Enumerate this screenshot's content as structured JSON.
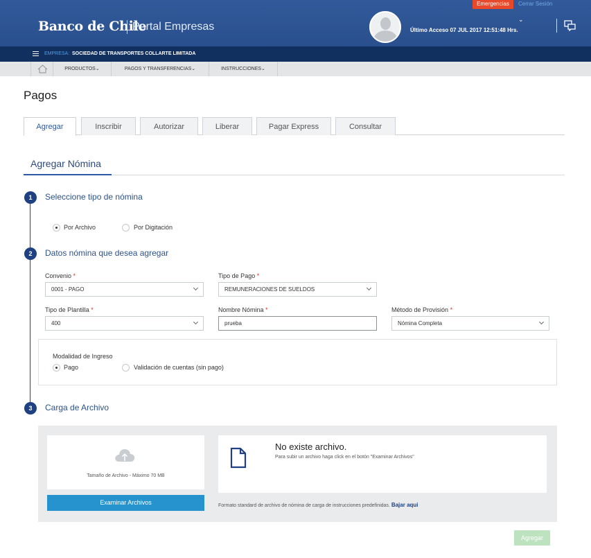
{
  "header": {
    "logo": "Banco de Chile",
    "portal": "Portal Empresas",
    "emergency_label": "Emergencias",
    "logout_label": "Cerrar Sesión",
    "last_access": "Último Acceso 07 JUL 2017 12:51:48 Hrs."
  },
  "company": {
    "label": "EMPRESA:",
    "name": "SOCIEDAD DE TRANSPORTES COLLARTE LIMITADA"
  },
  "nav": {
    "items": [
      "PRODUCTOS",
      "PAGOS Y TRANSFERENCIAS",
      "INSTRUCCIONES"
    ]
  },
  "page": {
    "title": "Pagos",
    "tabs": [
      "Agregar",
      "Inscribir",
      "Autorizar",
      "Liberar",
      "Pagar Express",
      "Consultar"
    ],
    "active_tab": "Agregar",
    "subtitle": "Agregar Nómina"
  },
  "steps": [
    {
      "num": "1",
      "title": "Seleccione tipo de nómina"
    },
    {
      "num": "2",
      "title": "Datos nómina que desea agregar"
    },
    {
      "num": "3",
      "title": "Carga de Archivo"
    }
  ],
  "nomina_type": {
    "options": [
      "Por Archivo",
      "Por Digitación"
    ],
    "selected": "Por Archivo"
  },
  "form": {
    "convenio": {
      "label": "Convenio",
      "value": "0001 - PAGO"
    },
    "tipo_pago": {
      "label": "Tipo de Pago",
      "value": "REMUNERACIONES DE SUELDOS"
    },
    "tipo_plantilla": {
      "label": "Tipo de Plantilla",
      "value": "400"
    },
    "nombre_nomina": {
      "label": "Nombre Nómina",
      "value": "prueba"
    },
    "metodo_provision": {
      "label": "Método de Provisión",
      "value": "Nómina Completa"
    },
    "required_mark": "*"
  },
  "modalidad": {
    "label": "Modalidad de Ingreso",
    "options": [
      "Pago",
      "Validación de cuentas (sin pago)"
    ],
    "selected": "Pago"
  },
  "upload": {
    "size_label": "Tamaño de Archivo - Máximo 70 MB",
    "browse_label": "Examinar Archivos",
    "no_file_title": "No existe archivo.",
    "no_file_desc": "Para subir un archivo haga click en el botón \"Examinar Archivos\"",
    "format_text": "Formato standard de archivo de nómina de carga de instrucciones predefinidas.",
    "format_link": "Bajar aqui"
  },
  "actions": {
    "submit_label": "Agregar"
  },
  "colors": {
    "header": "#294f8d",
    "company_bar": "#12305f",
    "accent": "#1f4181",
    "emergency": "#e8492a",
    "browse": "#2793ce",
    "submit_disabled": "#bde2bf"
  },
  "icons": [
    "home-icon",
    "chat-icon",
    "cloud-upload-icon",
    "document-icon",
    "hamburger-icon"
  ]
}
